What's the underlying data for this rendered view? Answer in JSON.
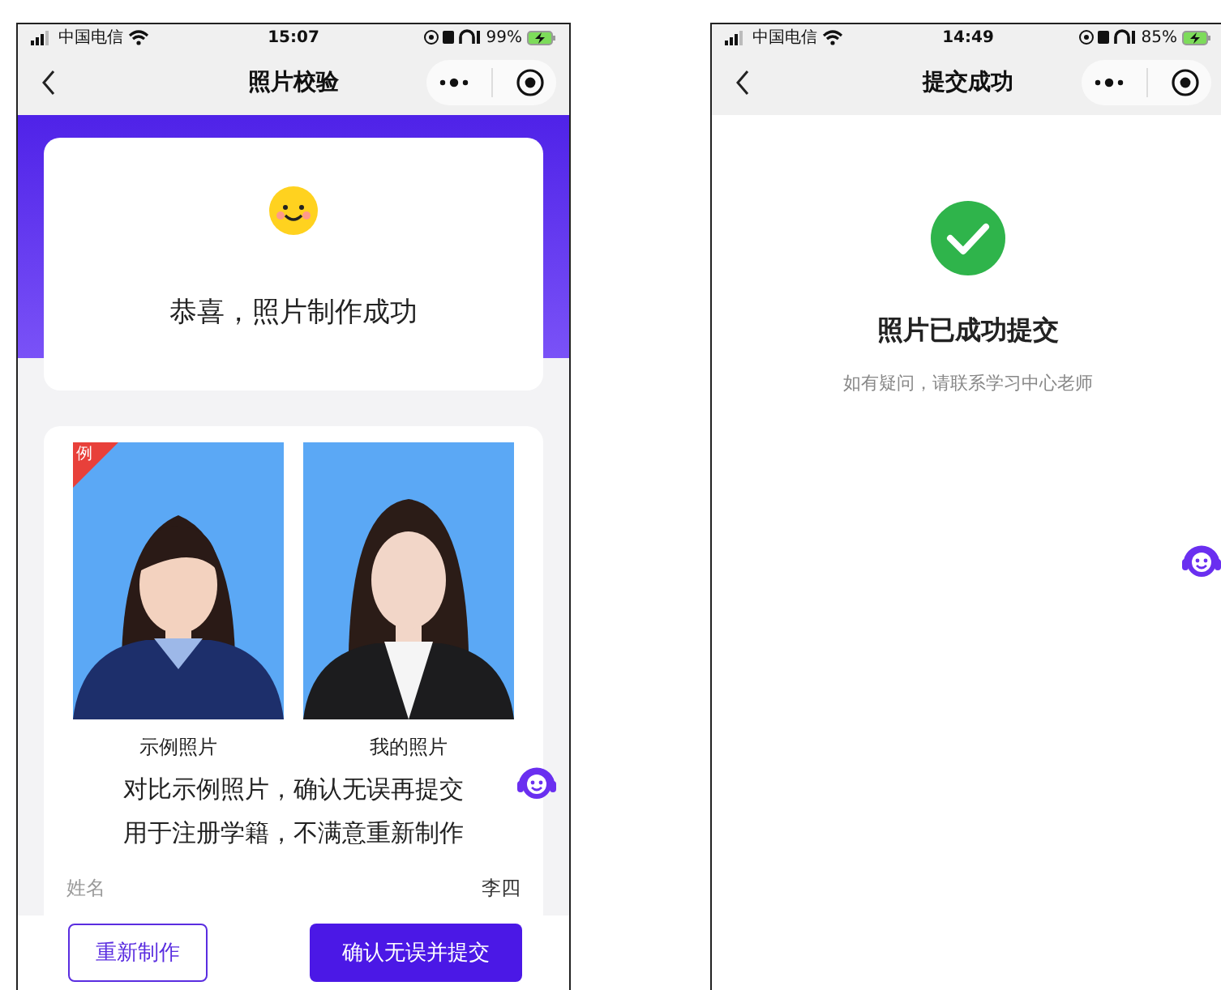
{
  "screens": [
    {
      "kind": "check",
      "status_bar": {
        "carrier": "中国电信",
        "time": "15:07",
        "battery": "99%"
      },
      "nav": {
        "title": "照片校验"
      },
      "result_card": {
        "title": "恭喜，照片制作成功"
      },
      "photos": [
        {
          "caption": "示例照片",
          "badge": "例",
          "kind": "sample"
        },
        {
          "caption": "我的照片",
          "kind": "mine"
        }
      ],
      "notice": [
        "对比示例照片，确认无误再提交",
        "用于注册学籍，不满意重新制作"
      ],
      "fields": [
        {
          "label": "姓名",
          "value": "李四"
        }
      ],
      "buttons": [
        {
          "label": "重新制作",
          "kind": "outline"
        },
        {
          "label": "确认无误并提交",
          "kind": "primary"
        }
      ]
    },
    {
      "kind": "success",
      "status_bar": {
        "carrier": "中国电信",
        "time": "14:49",
        "battery": "85%"
      },
      "nav": {
        "title": "提交成功"
      },
      "success": {
        "title": "照片已成功提交",
        "subtitle": "如有疑问，请联系学习中心老师"
      }
    }
  ]
}
